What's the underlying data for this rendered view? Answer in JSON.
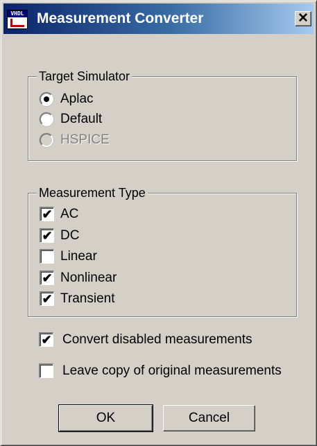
{
  "window": {
    "title": "Measurement Converter",
    "icon_label": "VHDL",
    "close_glyph": "✕"
  },
  "target_simulator": {
    "title": "Target Simulator",
    "options": [
      {
        "label": "Aplac",
        "selected": true,
        "enabled": true
      },
      {
        "label": "Default",
        "selected": false,
        "enabled": true
      },
      {
        "label": "HSPICE",
        "selected": false,
        "enabled": false
      }
    ]
  },
  "measurement_type": {
    "title": "Measurement Type",
    "items": [
      {
        "label": "AC",
        "checked": true
      },
      {
        "label": "DC",
        "checked": true
      },
      {
        "label": "Linear",
        "checked": false
      },
      {
        "label": "Nonlinear",
        "checked": true
      },
      {
        "label": "Transient",
        "checked": true
      }
    ]
  },
  "options": {
    "convert_disabled": {
      "label": "Convert disabled measurements",
      "checked": true
    },
    "leave_copy": {
      "label": "Leave copy of original measurements",
      "checked": false
    }
  },
  "buttons": {
    "ok": "OK",
    "cancel": "Cancel"
  },
  "check_glyph": "✔"
}
